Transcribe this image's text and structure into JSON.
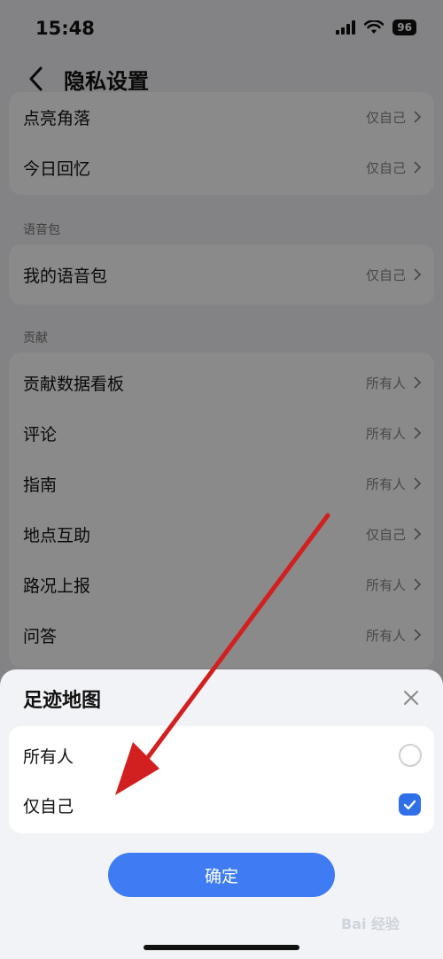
{
  "status_bar": {
    "time": "15:48",
    "battery": "96"
  },
  "nav": {
    "title": "隐私设置"
  },
  "groups": [
    {
      "items": [
        {
          "label": "点亮角落",
          "value": "仅自己"
        },
        {
          "label": "今日回忆",
          "value": "仅自己"
        }
      ]
    },
    {
      "title": "语音包",
      "items": [
        {
          "label": "我的语音包",
          "value": "仅自己"
        }
      ]
    },
    {
      "title": "贡献",
      "items": [
        {
          "label": "贡献数据看板",
          "value": "所有人"
        },
        {
          "label": "评论",
          "value": "所有人"
        },
        {
          "label": "指南",
          "value": "所有人"
        },
        {
          "label": "地点互助",
          "value": "仅自己"
        },
        {
          "label": "路况上报",
          "value": "所有人"
        },
        {
          "label": "问答",
          "value": "所有人"
        }
      ]
    }
  ],
  "sheet": {
    "title": "足迹地图",
    "options": [
      {
        "label": "所有人",
        "selected": false
      },
      {
        "label": "仅自己",
        "selected": true
      }
    ],
    "confirm_label": "确定"
  },
  "watermark": "Bai 经验",
  "colors": {
    "accent": "#3f7cf3",
    "arrow": "#d21f1f"
  }
}
